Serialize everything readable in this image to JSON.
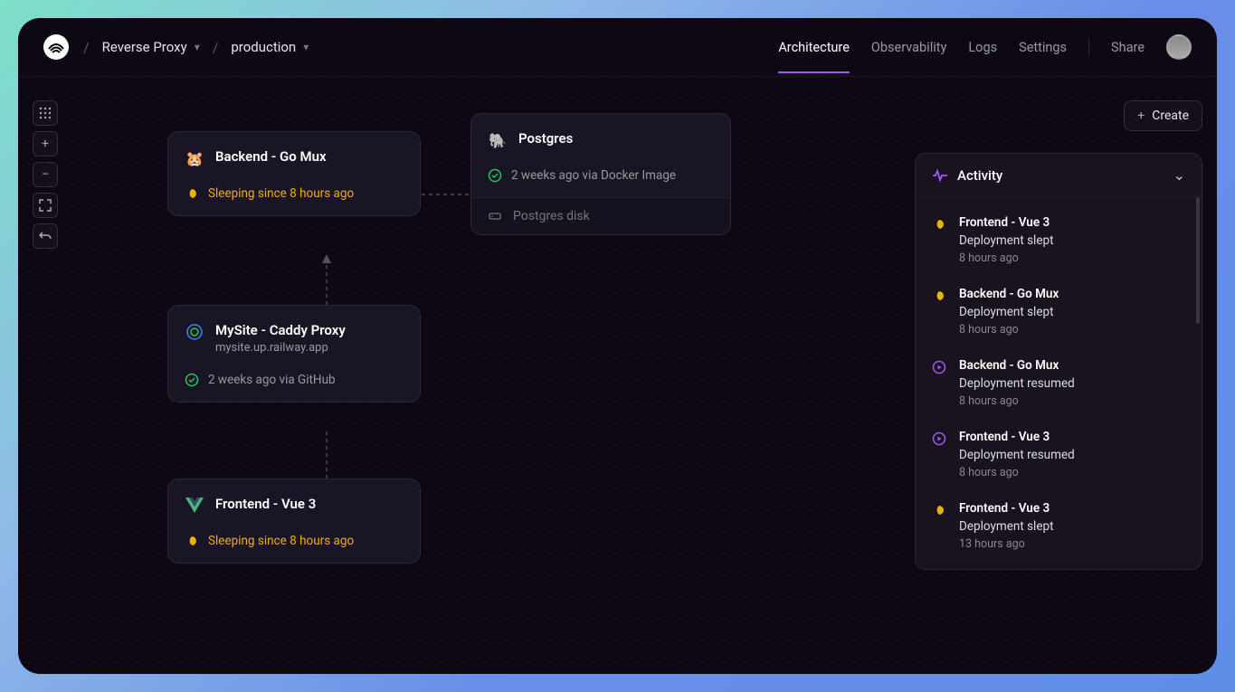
{
  "breadcrumb": {
    "project": "Reverse Proxy",
    "env": "production"
  },
  "nav": {
    "architecture": "Architecture",
    "observability": "Observability",
    "logs": "Logs",
    "settings": "Settings",
    "share": "Share"
  },
  "create_label": "Create",
  "nodes": {
    "backend": {
      "title": "Backend - Go Mux",
      "status": "Sleeping since 8 hours ago"
    },
    "postgres": {
      "title": "Postgres",
      "status": "2 weeks ago via Docker Image",
      "disk": "Postgres disk"
    },
    "caddy": {
      "title": "MySite - Caddy Proxy",
      "subtitle": "mysite.up.railway.app",
      "status": "2 weeks ago via GitHub"
    },
    "frontend": {
      "title": "Frontend - Vue 3",
      "status": "Sleeping since 8 hours ago"
    }
  },
  "activity": {
    "title": "Activity",
    "items": [
      {
        "name": "Frontend - Vue 3",
        "desc": "Deployment slept",
        "time": "8 hours ago",
        "icon": "sleep"
      },
      {
        "name": "Backend - Go Mux",
        "desc": "Deployment slept",
        "time": "8 hours ago",
        "icon": "sleep"
      },
      {
        "name": "Backend - Go Mux",
        "desc": "Deployment resumed",
        "time": "8 hours ago",
        "icon": "resume"
      },
      {
        "name": "Frontend - Vue 3",
        "desc": "Deployment resumed",
        "time": "8 hours ago",
        "icon": "resume"
      },
      {
        "name": "Frontend - Vue 3",
        "desc": "Deployment slept",
        "time": "13 hours ago",
        "icon": "sleep"
      }
    ]
  }
}
